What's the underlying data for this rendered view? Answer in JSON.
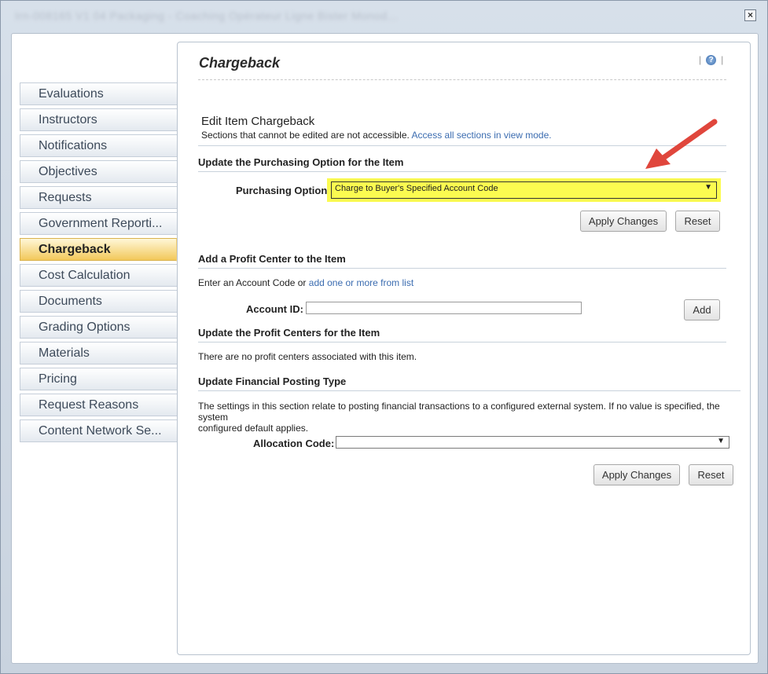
{
  "window": {
    "title": "Irn-008165 V1 04 Packaging - Coaching Opérateur Ligne Bister Monod...",
    "close": "×"
  },
  "sidebar": {
    "items": [
      {
        "label": "Evaluations"
      },
      {
        "label": "Instructors"
      },
      {
        "label": "Notifications"
      },
      {
        "label": "Objectives"
      },
      {
        "label": "Requests"
      },
      {
        "label": "Government Reporti..."
      },
      {
        "label": "Chargeback",
        "active": true
      },
      {
        "label": "Cost Calculation"
      },
      {
        "label": "Documents"
      },
      {
        "label": "Grading Options"
      },
      {
        "label": "Materials"
      },
      {
        "label": "Pricing"
      },
      {
        "label": "Request Reasons"
      },
      {
        "label": "Content Network Se..."
      }
    ]
  },
  "main": {
    "page_title": "Chargeback",
    "help_glyph": "?",
    "edit_heading": "Edit Item Chargeback",
    "edit_sub": "Sections that cannot be edited are not accessible.",
    "edit_sub_link": "Access all sections in view mode.",
    "purchasing": {
      "heading": "Update the Purchasing Option for the Item",
      "label": "Purchasing Option:",
      "selected": "Charge to Buyer's Specified Account Code",
      "apply": "Apply Changes",
      "reset": "Reset"
    },
    "profit_center": {
      "heading": "Add a Profit Center to the Item",
      "intro": "Enter an Account Code or",
      "intro_link": "add one or more from list",
      "account_label": "Account ID:",
      "account_value": "",
      "add": "Add"
    },
    "profit_centers_update": {
      "heading": "Update the Profit Centers for the Item",
      "empty": "There are no profit centers associated with this item."
    },
    "financial": {
      "heading": "Update Financial Posting Type",
      "desc_line1": "The settings in this section relate to posting financial transactions to a configured external system. If no value is specified, the system",
      "desc_line2": "configured default applies.",
      "alloc_label": "Allocation Code:",
      "alloc_value": "",
      "apply": "Apply Changes",
      "reset": "Reset"
    }
  },
  "colors": {
    "highlight": "#fbfb50",
    "annotation_arrow": "#e0463c",
    "link": "#3b6cb0"
  }
}
